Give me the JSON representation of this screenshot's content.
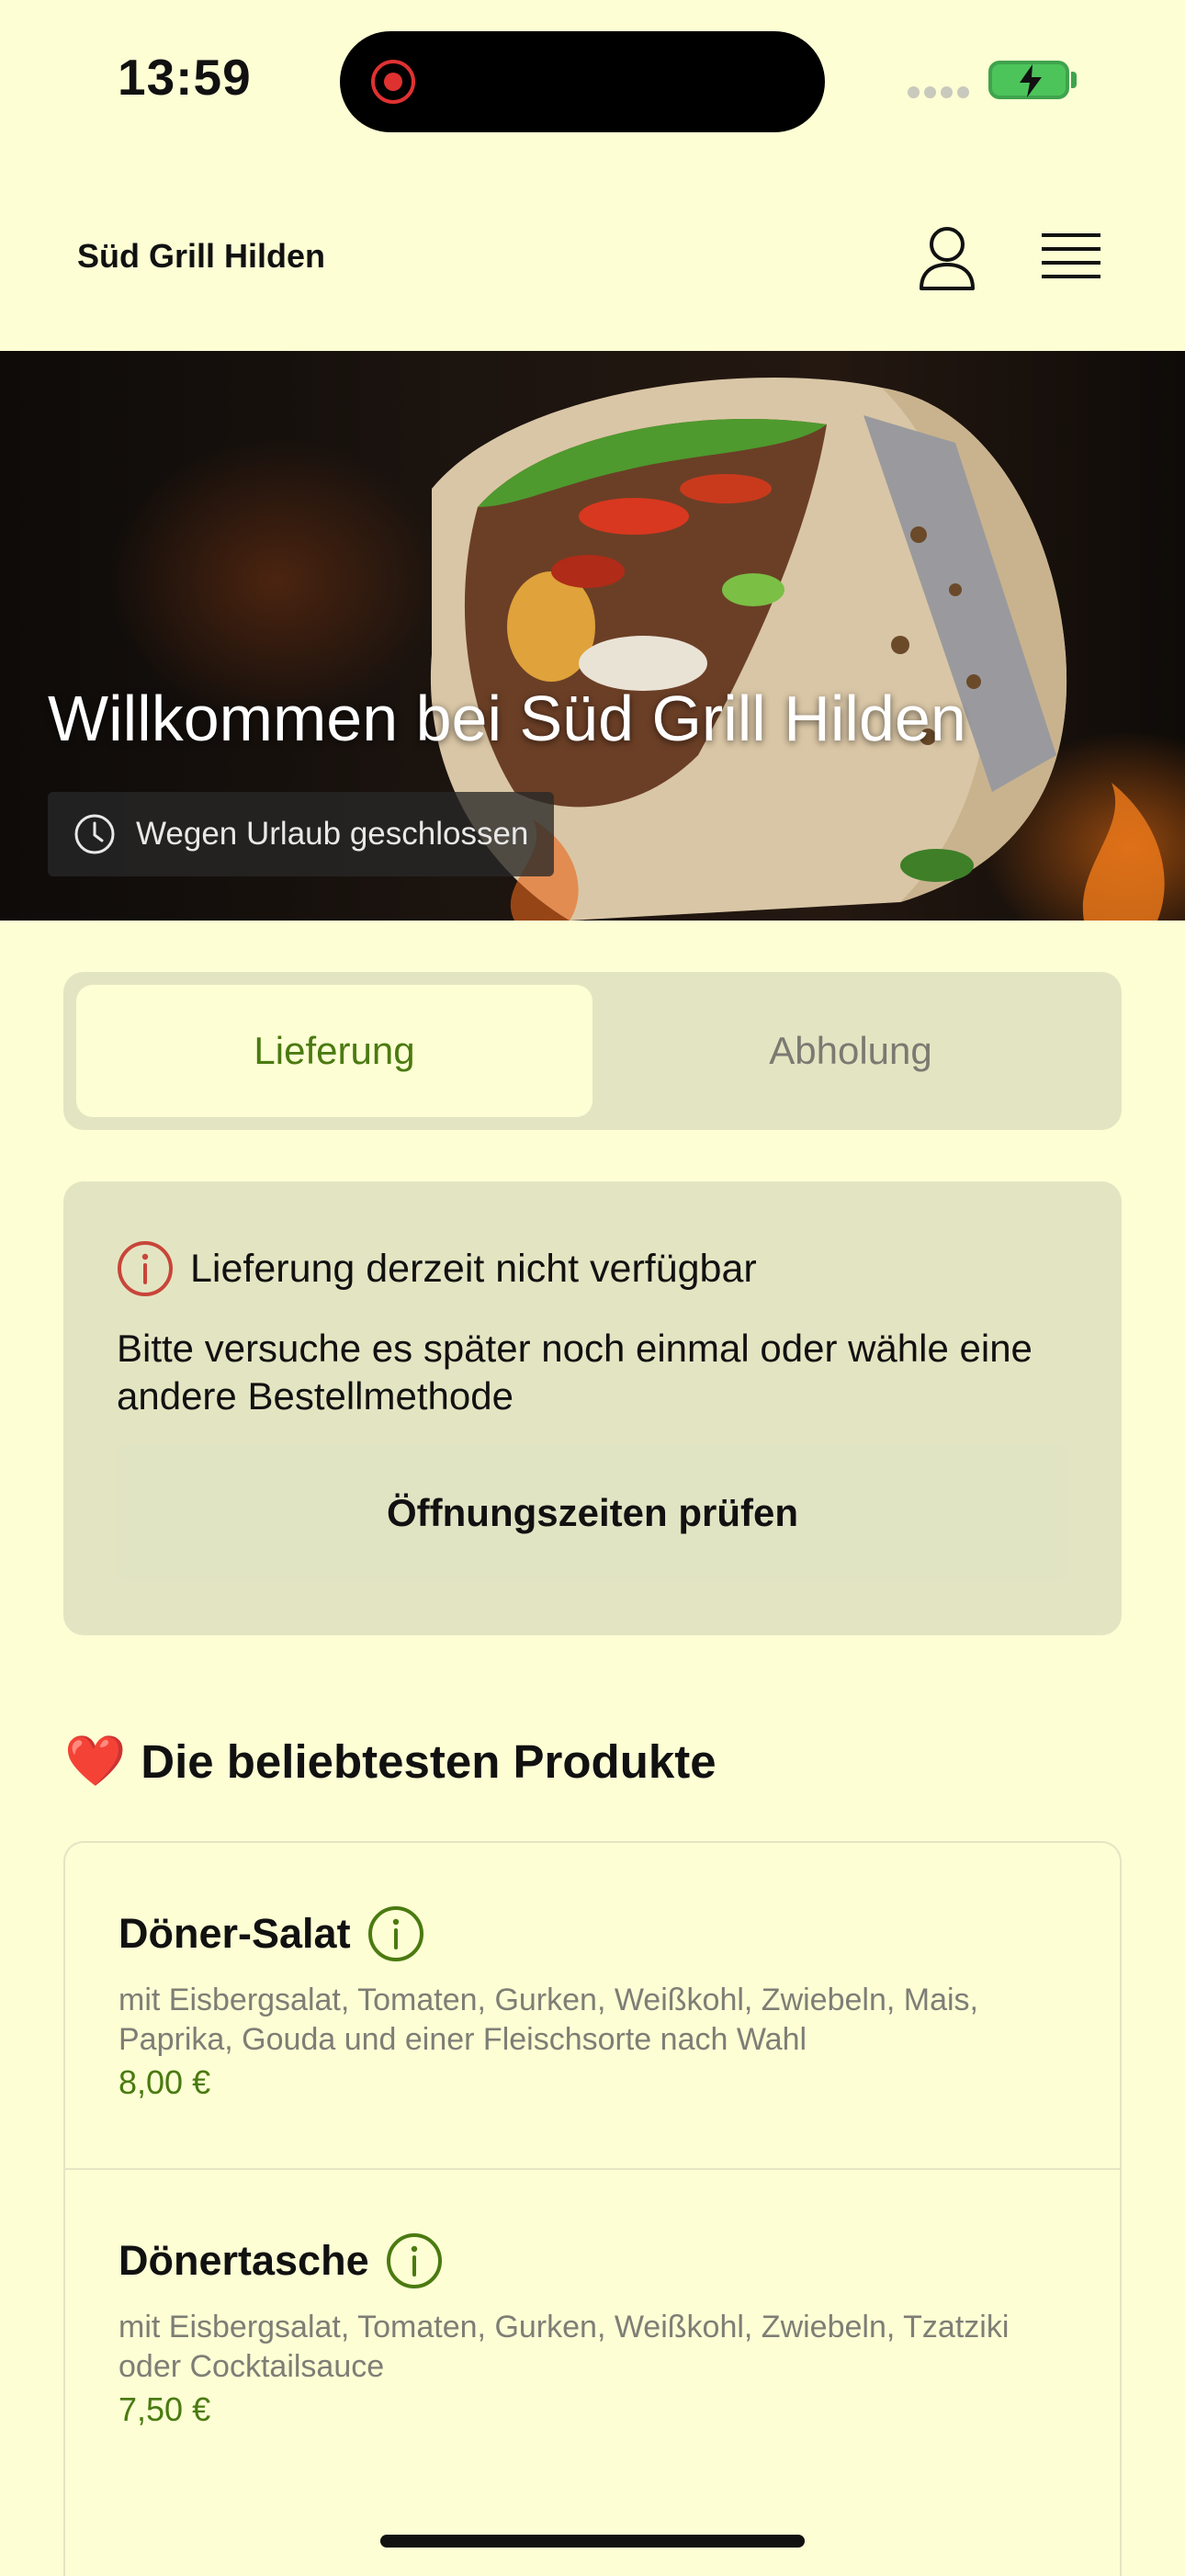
{
  "status_bar": {
    "time": "13:59",
    "icons": [
      "recording-indicator-icon",
      "signal-dots-icon",
      "battery-charging-icon"
    ]
  },
  "header": {
    "brand": "Süd Grill Hilden",
    "icons": [
      "person-icon",
      "hamburger-menu-icon"
    ]
  },
  "hero": {
    "title": "Willkommen bei Süd Grill Hilden",
    "status": "Wegen Urlaub geschlossen",
    "status_icon": "clock-icon"
  },
  "order_mode": {
    "options": [
      "Lieferung",
      "Abholung"
    ],
    "selected": "Lieferung"
  },
  "notice": {
    "icon": "info-icon",
    "title": "Lieferung derzeit nicht verfügbar",
    "text": "Bitte versuche es später noch einmal oder wähle eine andere Bestellmethode",
    "button": "Öffnungszeiten prüfen"
  },
  "popular": {
    "emoji": "❤️",
    "title": "Die beliebtesten Produkte",
    "items": [
      {
        "name": "Döner-Salat",
        "description": "mit Eisbergsalat, Tomaten, Gurken, Weißkohl, Zwiebeln, Mais, Paprika, Gouda und einer Fleischsorte nach Wahl",
        "price": "8,00 €"
      },
      {
        "name": "Dönertasche",
        "description": "mit Eisbergsalat, Tomaten, Gurken, Weißkohl, Zwiebeln, Tzatziki oder Cocktailsauce",
        "price": "7,50 €"
      }
    ]
  },
  "colors": {
    "background": "#fdfed4",
    "panel": "#e3e5c2",
    "accent_green": "#4a7a10",
    "alert_red": "#c8453a",
    "text": "#111111",
    "muted": "#7e7e76"
  }
}
